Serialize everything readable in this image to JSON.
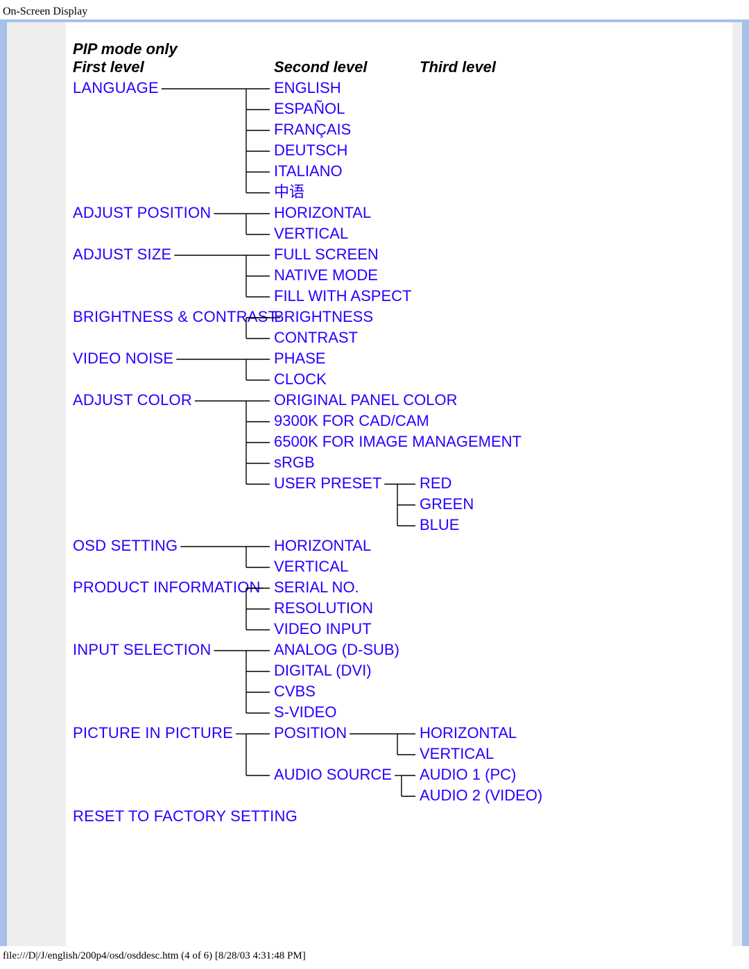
{
  "page": {
    "title": "On-Screen Display",
    "footer": "file:///D|/J/english/200p4/osd/osddesc.htm (4 of 6) [8/28/03 4:31:48 PM]"
  },
  "headers": {
    "note": "PIP mode only",
    "c1": "First level",
    "c2": "Second level",
    "c3": "Third level"
  },
  "tree": [
    {
      "label": "LANGUAGE",
      "children": [
        {
          "label": "ENGLISH"
        },
        {
          "label": "ESPAÑOL"
        },
        {
          "label": "FRANÇAIS"
        },
        {
          "label": "DEUTSCH"
        },
        {
          "label": "ITALIANO"
        },
        {
          "label": "中语"
        }
      ]
    },
    {
      "label": "ADJUST POSITION",
      "children": [
        {
          "label": "HORIZONTAL"
        },
        {
          "label": "VERTICAL"
        }
      ]
    },
    {
      "label": "ADJUST SIZE",
      "children": [
        {
          "label": "FULL SCREEN"
        },
        {
          "label": "NATIVE MODE"
        },
        {
          "label": "FILL WITH ASPECT"
        }
      ]
    },
    {
      "label": "BRIGHTNESS & CONTRAST",
      "children": [
        {
          "label": "BRIGHTNESS"
        },
        {
          "label": "CONTRAST"
        }
      ]
    },
    {
      "label": "VIDEO NOISE",
      "children": [
        {
          "label": "PHASE"
        },
        {
          "label": "CLOCK"
        }
      ]
    },
    {
      "label": "ADJUST COLOR",
      "children": [
        {
          "label": "ORIGINAL PANEL COLOR"
        },
        {
          "label": "9300K FOR CAD/CAM"
        },
        {
          "label": "6500K FOR IMAGE MANAGEMENT"
        },
        {
          "label": "sRGB"
        },
        {
          "label": "USER PRESET",
          "children": [
            {
              "label": "RED"
            },
            {
              "label": "GREEN"
            },
            {
              "label": "BLUE"
            }
          ]
        }
      ]
    },
    {
      "label": "OSD SETTING",
      "children": [
        {
          "label": "HORIZONTAL"
        },
        {
          "label": "VERTICAL"
        }
      ]
    },
    {
      "label": "PRODUCT INFORMATION",
      "children": [
        {
          "label": "SERIAL NO."
        },
        {
          "label": "RESOLUTION"
        },
        {
          "label": "VIDEO INPUT"
        }
      ]
    },
    {
      "label": "INPUT SELECTION",
      "children": [
        {
          "label": "ANALOG (D-SUB)"
        },
        {
          "label": "DIGITAL (DVI)"
        },
        {
          "label": "CVBS"
        },
        {
          "label": "S-VIDEO"
        }
      ]
    },
    {
      "label": "PICTURE IN PICTURE",
      "children": [
        {
          "label": "POSITION",
          "children": [
            {
              "label": "HORIZONTAL"
            },
            {
              "label": "VERTICAL"
            }
          ]
        },
        {
          "label": "AUDIO SOURCE",
          "children": [
            {
              "label": "AUDIO 1 (PC)"
            },
            {
              "label": "AUDIO 2 (VIDEO)"
            }
          ]
        }
      ]
    },
    {
      "label": "RESET TO FACTORY SETTING"
    }
  ]
}
